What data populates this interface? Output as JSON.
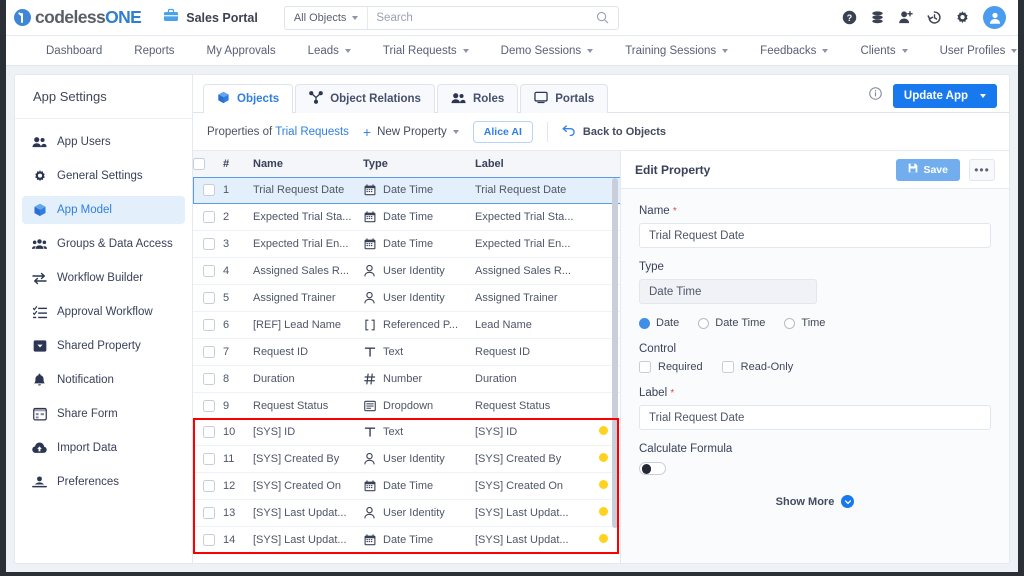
{
  "header": {
    "logo_primary": "codeless",
    "logo_accent": "ONE",
    "portal_name": "Sales Portal",
    "search_scope": "All Objects",
    "search_placeholder": "Search",
    "search_value": "",
    "icons": [
      "help-icon",
      "database-icon",
      "add-user-icon",
      "history-icon",
      "gear-icon",
      "avatar"
    ]
  },
  "nav": {
    "items": [
      {
        "label": "Dashboard",
        "has_caret": false
      },
      {
        "label": "Reports",
        "has_caret": false
      },
      {
        "label": "My Approvals",
        "has_caret": false
      },
      {
        "label": "Leads",
        "has_caret": true
      },
      {
        "label": "Trial Requests",
        "has_caret": true
      },
      {
        "label": "Demo Sessions",
        "has_caret": true
      },
      {
        "label": "Training Sessions",
        "has_caret": true
      },
      {
        "label": "Feedbacks",
        "has_caret": true
      },
      {
        "label": "Clients",
        "has_caret": true
      },
      {
        "label": "User Profiles",
        "has_caret": true
      }
    ]
  },
  "sidebar": {
    "title": "App Settings",
    "items": [
      {
        "label": "App Users",
        "icon": "users-icon",
        "active": false
      },
      {
        "label": "General Settings",
        "icon": "gear-icon",
        "active": false
      },
      {
        "label": "App Model",
        "icon": "cube-icon",
        "active": true
      },
      {
        "label": "Groups & Data Access",
        "icon": "group-icon",
        "active": false
      },
      {
        "label": "Workflow Builder",
        "icon": "arrows-icon",
        "active": false
      },
      {
        "label": "Approval Workflow",
        "icon": "checklist-icon",
        "active": false
      },
      {
        "label": "Shared Property",
        "icon": "dropdown-box-icon",
        "active": false
      },
      {
        "label": "Notification",
        "icon": "bell-icon",
        "active": false
      },
      {
        "label": "Share Form",
        "icon": "form-icon",
        "active": false
      },
      {
        "label": "Import Data",
        "icon": "cloud-upload-icon",
        "active": false
      },
      {
        "label": "Preferences",
        "icon": "preferences-icon",
        "active": false
      }
    ]
  },
  "tabs": [
    {
      "label": "Objects",
      "icon": "cube-icon",
      "active": true
    },
    {
      "label": "Object Relations",
      "icon": "relations-icon",
      "active": false
    },
    {
      "label": "Roles",
      "icon": "roles-icon",
      "active": false
    },
    {
      "label": "Portals",
      "icon": "portal-icon",
      "active": false
    }
  ],
  "toolbar": {
    "info_icon": "info-icon",
    "update_label": "Update App"
  },
  "propbar": {
    "properties_of": "Properties of",
    "object_name": "Trial Requests",
    "new_property": "New Property",
    "alice_ai": "Alice AI",
    "back_to_objects": "Back to Objects"
  },
  "table": {
    "columns": [
      "#",
      "Name",
      "Type",
      "Label"
    ],
    "rows": [
      {
        "num": "1",
        "name": "Trial Request Date",
        "type": "Date Time",
        "type_icon": "calendar-icon",
        "label": "Trial Request Date",
        "dot": false,
        "selected": true
      },
      {
        "num": "2",
        "name": "Expected Trial Sta...",
        "type": "Date Time",
        "type_icon": "calendar-icon",
        "label": "Expected Trial Sta...",
        "dot": false,
        "selected": false
      },
      {
        "num": "3",
        "name": "Expected Trial En...",
        "type": "Date Time",
        "type_icon": "calendar-icon",
        "label": "Expected Trial En...",
        "dot": false,
        "selected": false
      },
      {
        "num": "4",
        "name": "Assigned Sales R...",
        "type": "User Identity",
        "type_icon": "user-icon",
        "label": "Assigned Sales R...",
        "dot": false,
        "selected": false
      },
      {
        "num": "5",
        "name": "Assigned Trainer",
        "type": "User Identity",
        "type_icon": "user-icon",
        "label": "Assigned Trainer",
        "dot": false,
        "selected": false
      },
      {
        "num": "6",
        "name": "[REF] Lead Name",
        "type": "Referenced P...",
        "type_icon": "brackets-icon",
        "label": "Lead Name",
        "dot": false,
        "selected": false
      },
      {
        "num": "7",
        "name": "Request ID",
        "type": "Text",
        "type_icon": "text-icon",
        "label": "Request ID",
        "dot": false,
        "selected": false
      },
      {
        "num": "8",
        "name": "Duration",
        "type": "Number",
        "type_icon": "hash-icon",
        "label": "Duration",
        "dot": false,
        "selected": false
      },
      {
        "num": "9",
        "name": "Request Status",
        "type": "Dropdown",
        "type_icon": "dropdown-icon",
        "label": "Request Status",
        "dot": false,
        "selected": false
      },
      {
        "num": "10",
        "name": "[SYS] ID",
        "type": "Text",
        "type_icon": "text-icon",
        "label": "[SYS] ID",
        "dot": true,
        "selected": false
      },
      {
        "num": "11",
        "name": "[SYS] Created By",
        "type": "User Identity",
        "type_icon": "user-icon",
        "label": "[SYS] Created By",
        "dot": true,
        "selected": false
      },
      {
        "num": "12",
        "name": "[SYS] Created On",
        "type": "Date Time",
        "type_icon": "calendar-icon",
        "label": "[SYS] Created On",
        "dot": true,
        "selected": false
      },
      {
        "num": "13",
        "name": "[SYS] Last Updat...",
        "type": "User Identity",
        "type_icon": "user-icon",
        "label": "[SYS] Last Updat...",
        "dot": true,
        "selected": false
      },
      {
        "num": "14",
        "name": "[SYS] Last Updat...",
        "type": "Date Time",
        "type_icon": "calendar-icon",
        "label": "[SYS] Last Updat...",
        "dot": true,
        "selected": false
      }
    ],
    "highlight_color": "#fb0000",
    "status_dot_color": "#ffd21e"
  },
  "edit_property": {
    "title": "Edit Property",
    "save_label": "Save",
    "more_label": "•••",
    "name_label": "Name",
    "name_value": "Trial Request Date",
    "type_label": "Type",
    "type_value": "Date Time",
    "type_options": [
      {
        "label": "Date",
        "selected": true
      },
      {
        "label": "Date Time",
        "selected": false
      },
      {
        "label": "Time",
        "selected": false
      }
    ],
    "control_label": "Control",
    "control_options": [
      {
        "label": "Required",
        "checked": false
      },
      {
        "label": "Read-Only",
        "checked": false
      }
    ],
    "field_label": "Label",
    "field_value": "Trial Request Date",
    "calculate_formula_label": "Calculate Formula",
    "calculate_formula_on": false,
    "show_more": "Show More"
  }
}
